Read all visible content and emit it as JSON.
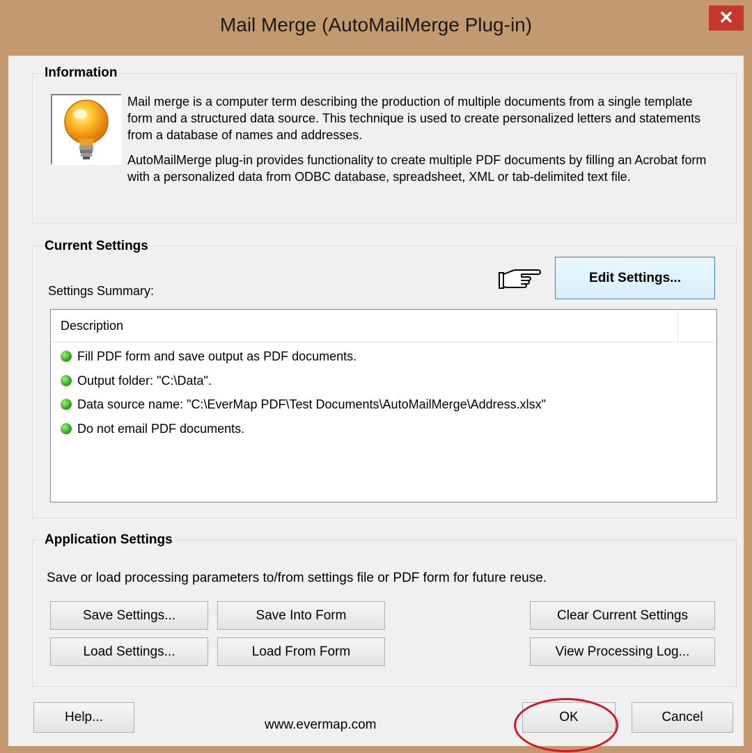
{
  "window": {
    "title": "Mail Merge (AutoMailMerge Plug-in)",
    "close_glyph": "✕"
  },
  "information": {
    "title": "Information",
    "paragraph1": "Mail merge is a computer term describing the production of multiple documents from a single template form and a structured data source. This technique is used to create personalized letters and statements from a database of names and addresses.",
    "paragraph2": "AutoMailMerge plug-in provides functionality to create multiple PDF documents by filling an Acrobat form with a personalized data from ODBC database, spreadsheet, XML or tab-delimited text file.",
    "icon": "lightbulb-icon"
  },
  "current_settings": {
    "title": "Current Settings",
    "summary_label": "Settings Summary:",
    "pointer_icon": "pointing-hand-icon",
    "edit_button": "Edit Settings...",
    "list_header": "Description",
    "items": [
      "Fill PDF form and save output as PDF documents.",
      "Output folder: \"C:\\Data\".",
      "Data source name: \"C:\\EverMap PDF\\Test Documents\\AutoMailMerge\\Address.xlsx\"",
      "Do not email PDF documents."
    ],
    "status_color": "#2ea81a"
  },
  "application_settings": {
    "title": "Application Settings",
    "description": "Save or load processing parameters to/from settings file or PDF form for future reuse.",
    "save_settings": "Save Settings...",
    "save_into_form": "Save Into Form",
    "clear_current_settings": "Clear Current Settings",
    "load_settings": "Load Settings...",
    "load_from_form": "Load From Form",
    "view_processing_log": "View Processing Log..."
  },
  "footer": {
    "help": "Help...",
    "website": "www.evermap.com",
    "ok": "OK",
    "cancel": "Cancel",
    "highlight_color": "#d9141f"
  }
}
